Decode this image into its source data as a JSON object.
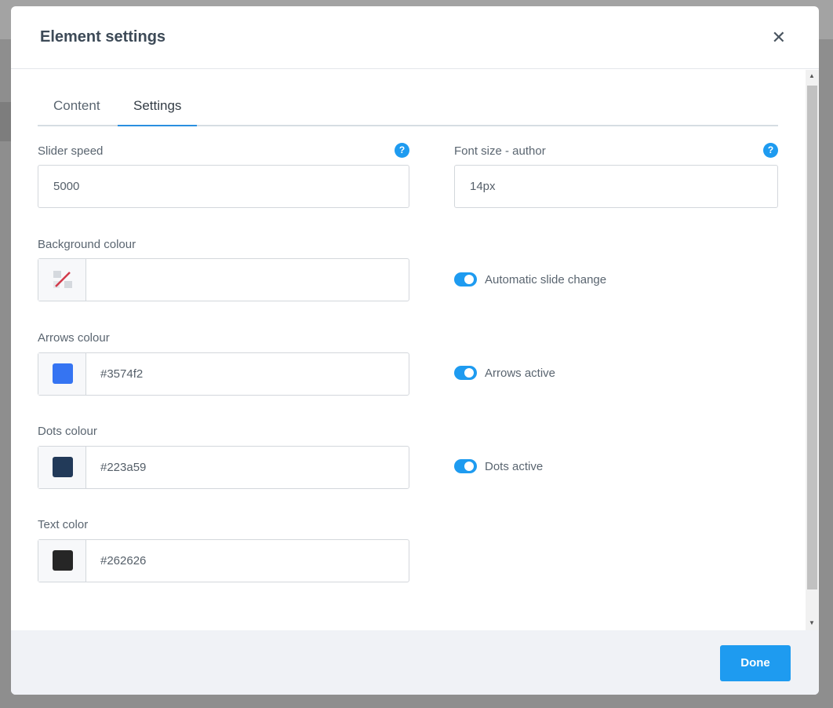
{
  "dialog": {
    "title": "Element settings",
    "close_icon": "close-icon"
  },
  "tabs": [
    {
      "label": "Content",
      "active": false
    },
    {
      "label": "Settings",
      "active": true
    }
  ],
  "fields": {
    "slider_speed": {
      "label": "Slider speed",
      "value": "5000"
    },
    "font_size_author": {
      "label": "Font size - author",
      "value": "14px"
    },
    "background_colour": {
      "label": "Background colour",
      "value": ""
    },
    "arrows_colour": {
      "label": "Arrows colour",
      "value": "#3574f2",
      "swatch": "#3574f2"
    },
    "dots_colour": {
      "label": "Dots colour",
      "value": "#223a59",
      "swatch": "#223a59"
    },
    "text_color": {
      "label": "Text color",
      "value": "#262626",
      "swatch": "#262626"
    }
  },
  "toggles": {
    "automatic_slide_change": {
      "label": "Automatic slide change",
      "on": true
    },
    "arrows_active": {
      "label": "Arrows active",
      "on": true
    },
    "dots_active": {
      "label": "Dots active",
      "on": true
    }
  },
  "help_glyph": "?",
  "footer": {
    "done_label": "Done"
  },
  "colors": {
    "accent": "#1e9bf0"
  }
}
